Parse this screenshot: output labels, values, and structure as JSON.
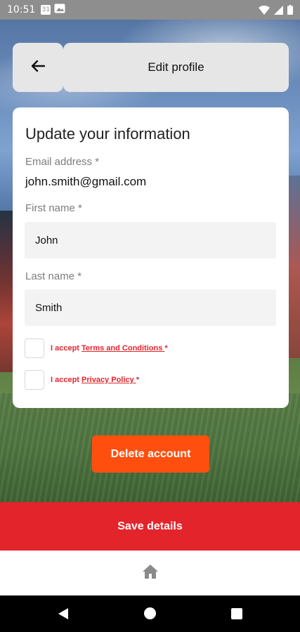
{
  "status_bar": {
    "time": "10:51",
    "notification_badge": "31",
    "icons": [
      "calendar-icon",
      "image-icon",
      "wifi-icon",
      "signal-icon",
      "battery-icon"
    ]
  },
  "header": {
    "title": "Edit profile",
    "back_icon": "arrow-left-icon"
  },
  "form": {
    "heading": "Update your information",
    "email_label": "Email address *",
    "email_value": "john.smith@gmail.com",
    "first_name_label": "First name *",
    "first_name_value": "John",
    "last_name_label": "Last name *",
    "last_name_value": "Smith",
    "terms_prefix": "I accept ",
    "terms_link": "Terms and Conditions ",
    "terms_suffix": "*",
    "privacy_prefix": "I accept ",
    "privacy_link": "Privacy Policy ",
    "privacy_suffix": "*"
  },
  "actions": {
    "delete_label": "Delete account",
    "save_label": "Save details"
  },
  "tab_bar": {
    "home_icon": "home-icon"
  },
  "colors": {
    "accent_red": "#e3242b",
    "delete_orange": "#ff4f0f",
    "header_gray": "#e6e6e6",
    "input_bg": "#f3f3f3"
  }
}
